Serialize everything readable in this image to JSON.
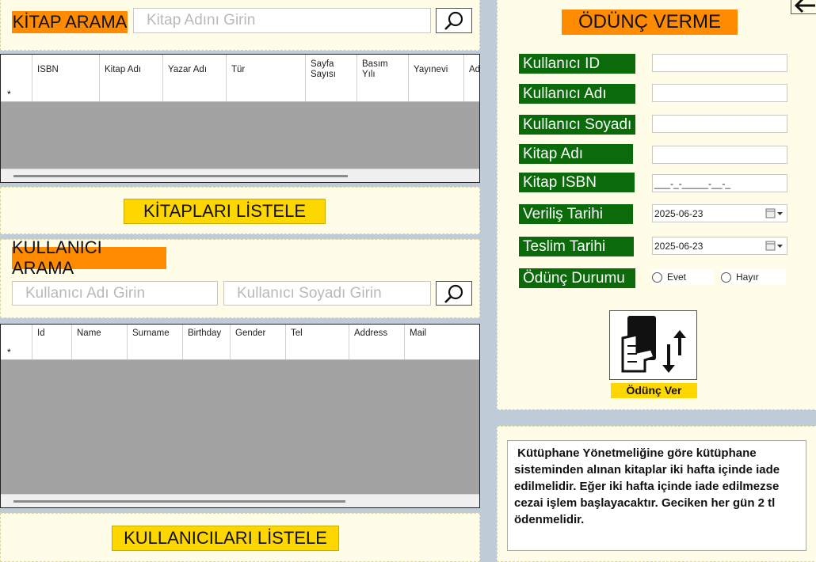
{
  "book_search": {
    "title": "KİTAP ARAMA",
    "placeholder": "Kitap Adını Girin",
    "columns": [
      "ISBN",
      "Kitap Adı",
      "Yazar Adı",
      "Tür",
      "Sayfa\nSayısı",
      "Basım\nYılı",
      "Yayınevi",
      "Ad"
    ],
    "new_row_marker": "*",
    "list_button": "KİTAPLARI LİSTELE"
  },
  "user_search": {
    "title": "KULLANICI ARAMA",
    "name_placeholder": "Kullanıcı Adı Girin",
    "surname_placeholder": "Kullanıcı Soyadı Girin",
    "columns": [
      "Id",
      "Name",
      "Surname",
      "Birthday",
      "Gender",
      "Tel",
      "Address",
      "Mail"
    ],
    "new_row_marker": "*",
    "list_button": "KULLANICILARI LİSTELE"
  },
  "loan": {
    "title": "ÖDÜNÇ VERME",
    "labels": {
      "user_id": "Kullanıcı ID",
      "user_name": "Kullanıcı Adı",
      "user_surname": "Kullanıcı Soyadı",
      "book_name": "Kitap Adı",
      "book_isbn": "Kitap ISBN",
      "issue_date": "Veriliş Tarihi",
      "return_date": "Teslim Tarihi",
      "loan_status": "Ödünç Durumu"
    },
    "isbn_mask": "___-_-_____-__-_",
    "issue_date_value": "2025-06-23",
    "return_date_value": "2025-06-23",
    "status_options": [
      "Evet",
      "Hayır"
    ],
    "action_label": "Ödünç Ver"
  },
  "info": {
    "text": " Kütüphane Yönetmeliğine göre kütüphane sisteminden alınan kitaplar iki hafta içinde iade edilmelidir. Eğer iki hafta içinde iade edilmezse  cezai işlem başlayacaktır. Geciken her gün 2 tl ödenmelidir."
  },
  "colors": {
    "panel_bg": "#fffde7",
    "window_bg": "#bfcbd6",
    "orange": "#ff8c00",
    "yellow": "#ffd700",
    "green": "#0b6b0b"
  },
  "icons": [
    "search-icon",
    "back-arrow-icon",
    "book-transfer-icon",
    "calendar-icon"
  ]
}
